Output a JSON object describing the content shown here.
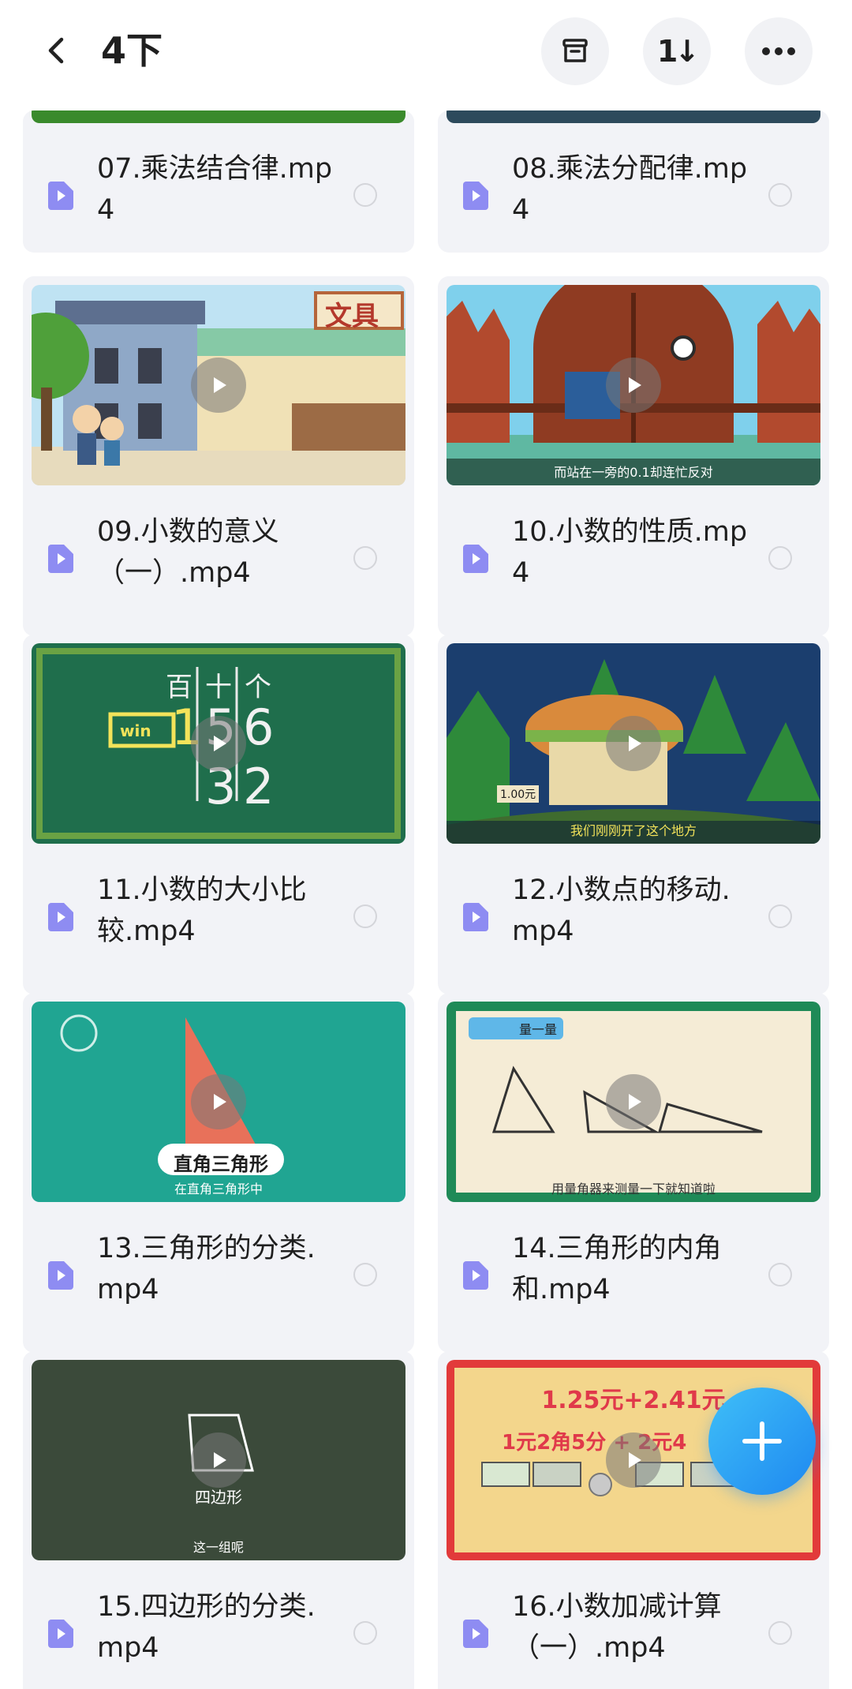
{
  "header": {
    "title": "4下",
    "sort_label": "1↓"
  },
  "files": [
    {
      "name": "07.乘法结合律.mp4"
    },
    {
      "name": "08.乘法分配律.mp4"
    },
    {
      "name": "09.小数的意义（一）.mp4",
      "thumb_label": "文具"
    },
    {
      "name": "10.小数的性质.mp4",
      "thumb_caption": "而站在一旁的0.1却连忙反对"
    },
    {
      "name": "11.小数的大小比较.mp4",
      "thumb_text": [
        "百",
        "十",
        "个",
        "1",
        "5",
        "6",
        "3",
        "2"
      ],
      "badge": "win"
    },
    {
      "name": "12.小数点的移动.mp4",
      "thumb_caption": "我们刚刚开了这个地方",
      "price": "1.00元"
    },
    {
      "name": "13.三角形的分类.mp4",
      "thumb_label": "直角三角形",
      "thumb_caption": "在直角三角形中"
    },
    {
      "name": "14.三角形的内角和.mp4",
      "thumb_label": "量一量",
      "thumb_caption": "用量角器来测量一下就知道啦"
    },
    {
      "name": "15.四边形的分类.mp4",
      "thumb_label": "四边形",
      "thumb_caption": "这一组呢"
    },
    {
      "name": "16.小数加减计算（一）.mp4",
      "thumb_line1": "1.25元+2.41元",
      "thumb_line2": "1元2角5分 + 2元4"
    }
  ],
  "colors": {
    "accent": "#1e88f0",
    "file_icon": "#8e8cf2",
    "card_bg": "#f2f3f7"
  }
}
